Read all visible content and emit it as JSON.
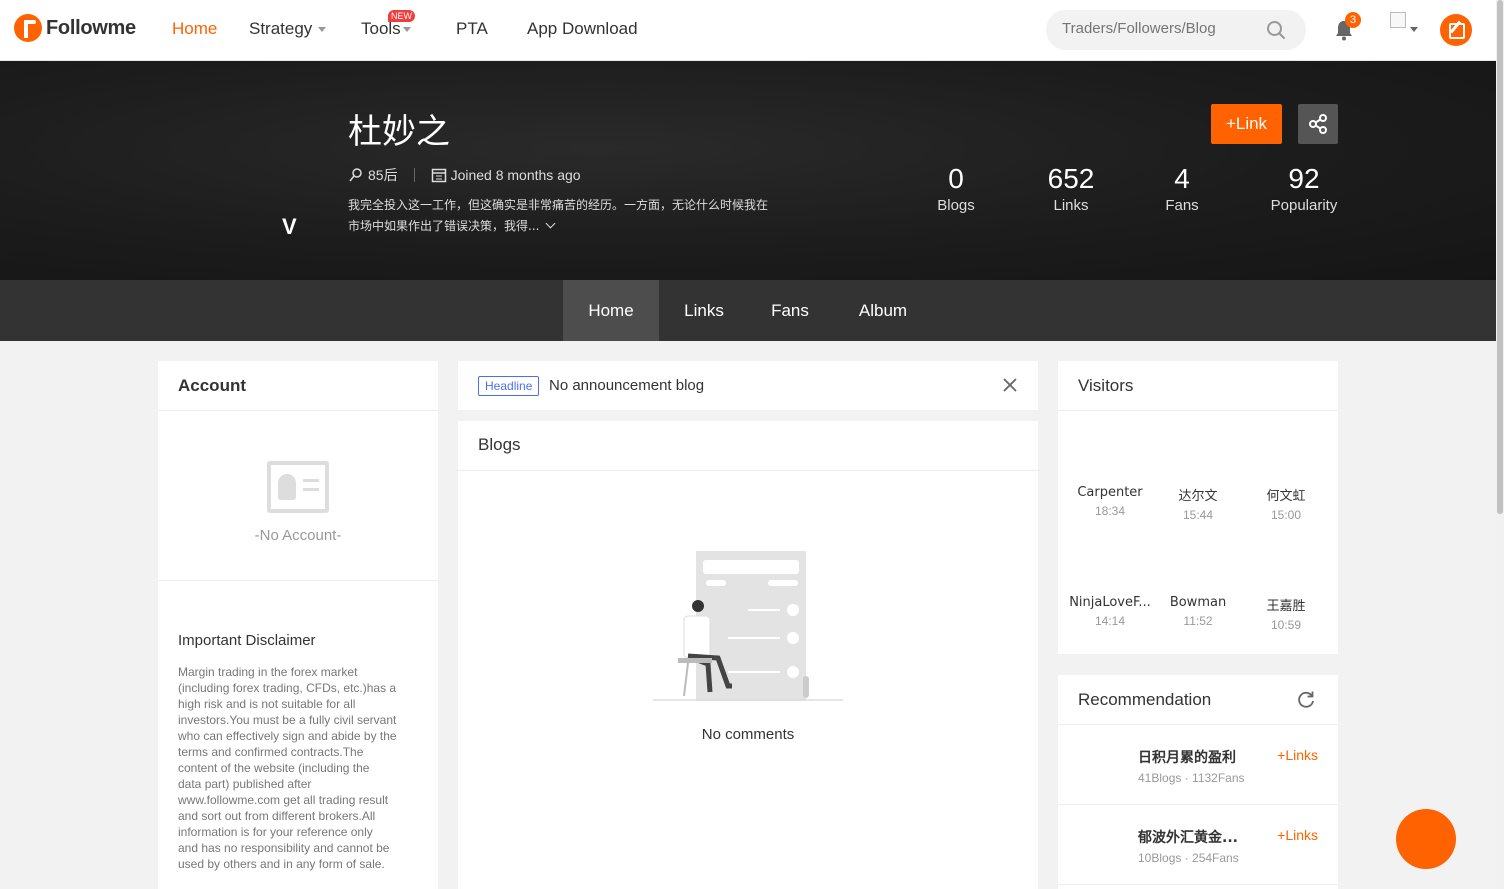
{
  "nav": {
    "logo_text": "Followme",
    "items": [
      {
        "label": "Home",
        "active": true
      },
      {
        "label": "Strategy",
        "dropdown": true
      },
      {
        "label": "Tools",
        "dropdown": true,
        "badge": "NEW"
      },
      {
        "label": "PTA"
      },
      {
        "label": "App Download"
      }
    ],
    "search_placeholder": "Traders/Followers/Blog",
    "notification_count": "3",
    "accent": "#ff6200"
  },
  "profile": {
    "name": "杜妙之",
    "age_group": "85后",
    "joined": "Joined 8 months ago",
    "bio_line1": "我完全投入这一工作，但这确实是非常痛苦的经历。一方面，无论什么时候我在",
    "bio_line2": "市场中如果作出了错误决策，我得...",
    "link_button": "Link",
    "badge_letter": "V",
    "stats": [
      {
        "value": "0",
        "label": "Blogs"
      },
      {
        "value": "652",
        "label": "Links"
      },
      {
        "value": "4",
        "label": "Fans"
      },
      {
        "value": "92",
        "label": "Popularity"
      }
    ]
  },
  "tabs": [
    {
      "label": "Home",
      "active": true
    },
    {
      "label": "Links"
    },
    {
      "label": "Fans"
    },
    {
      "label": "Album"
    }
  ],
  "account": {
    "title": "Account",
    "empty_text": "-No Account-",
    "disclaimer_title": "Important Disclaimer",
    "disclaimer_lines": [
      "Margin trading in the forex market",
      "(including forex trading, CFDs, etc.)has a",
      "high risk and is not suitable for all",
      "investors.You must be a fully civil servant",
      "who can effectively sign and abide by the",
      "terms and confirmed contracts.The",
      "content of the website (including the",
      "data part) published after",
      "www.followme.com get all trading result",
      "and sort out from different brokers.All",
      "information is for your reference only",
      "and has no responsibility and cannot be",
      "used by others and in any form of sale."
    ]
  },
  "announcement": {
    "tag": "Headline",
    "text": "No announcement blog"
  },
  "blogs": {
    "title": "Blogs",
    "empty_text": "No comments"
  },
  "visitors": {
    "title": "Visitors",
    "list": [
      {
        "name": "Carpenter",
        "time": "18:34"
      },
      {
        "name": "达尔文",
        "time": "15:44"
      },
      {
        "name": "何文虹",
        "time": "15:00"
      },
      {
        "name": "NinjaLoveF...",
        "time": "14:14"
      },
      {
        "name": "Bowman",
        "time": "11:52"
      },
      {
        "name": "王嘉胜",
        "time": "10:59"
      }
    ]
  },
  "recommendation": {
    "title": "Recommendation",
    "items": [
      {
        "name": "日积月累的盈利",
        "meta": "41Blogs · 1132Fans",
        "action": "Links"
      },
      {
        "name": "郁波外汇黄金...",
        "meta": "10Blogs · 254Fans",
        "action": "Links"
      }
    ]
  }
}
